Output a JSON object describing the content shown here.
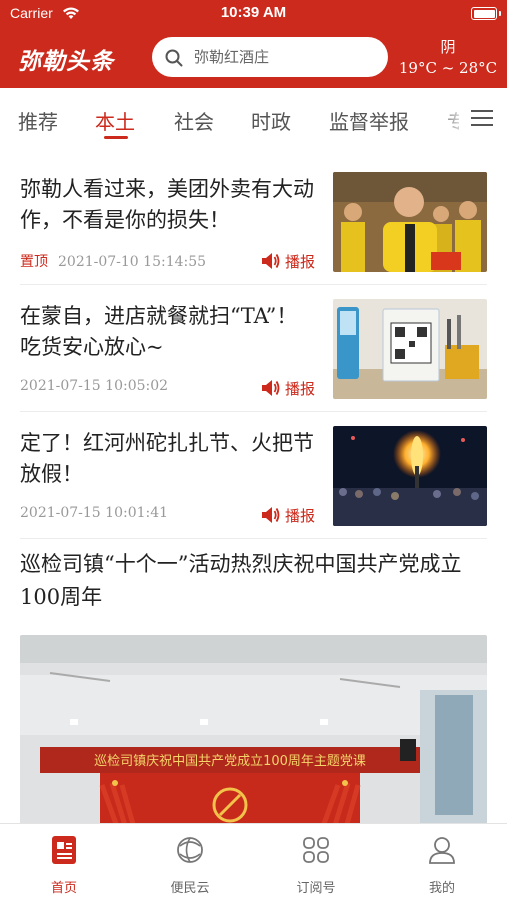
{
  "status_bar": {
    "carrier": "Carrier",
    "time": "10:39 AM"
  },
  "header": {
    "logo": "弥勒头条",
    "search": {
      "value": "弥勒红酒庄",
      "icon": "search-icon"
    },
    "weather": {
      "condition": "阴",
      "temperature": "19°C ~ 28°C"
    }
  },
  "tabs": [
    {
      "label": "推荐",
      "active": false
    },
    {
      "label": "本土",
      "active": true
    },
    {
      "label": "社会",
      "active": false
    },
    {
      "label": "时政",
      "active": false
    },
    {
      "label": "监督举报",
      "active": false
    },
    {
      "label": "专",
      "active": false
    }
  ],
  "menu_icon": "hamburger-menu-icon",
  "news": [
    {
      "title": "弥勒人看过来，美团外卖有大动作，不看是你的损失！",
      "tag": "置顶",
      "time": "2021-07-10 15:14:55",
      "broadcast": "播报"
    },
    {
      "title": "在蒙自，进店就餐就扫“TA”！吃货安心放心~",
      "tag": "",
      "time": "2021-07-15 10:05:02",
      "broadcast": "播报"
    },
    {
      "title": "定了！红河州砣扎扎节、火把节放假！",
      "tag": "",
      "time": "2021-07-15 10:01:41",
      "broadcast": "播报"
    }
  ],
  "feature": {
    "title": "巡检司镇“十个一”活动热烈庆祝中国共产党成立100周年",
    "banner_text": "巡检司镇庆祝中国共产党成立100周年主题党课"
  },
  "bottom_nav": [
    {
      "label": "首页",
      "icon": "home-news-icon",
      "active": true
    },
    {
      "label": "便民云",
      "icon": "cloud-service-icon",
      "active": false
    },
    {
      "label": "订阅号",
      "icon": "grid-subscribe-icon",
      "active": false
    },
    {
      "label": "我的",
      "icon": "user-profile-icon",
      "active": false
    }
  ],
  "colors": {
    "brand": "#cc2a1c",
    "text": "#222222",
    "meta": "#999999"
  }
}
